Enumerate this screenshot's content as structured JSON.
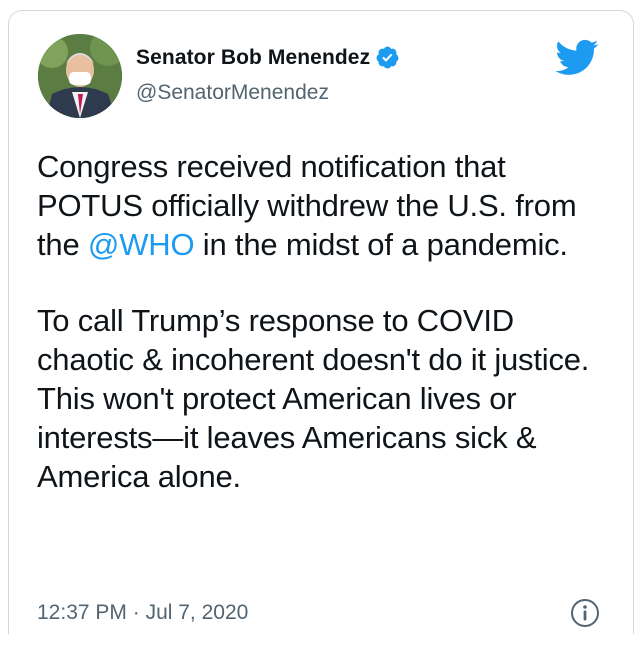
{
  "tweet": {
    "author_name": "Senator Bob Menendez",
    "handle": "@SenatorMenendez",
    "paragraph1": {
      "before_mention": "Congress received notification that POTUS officially withdrew the U.S. from the ",
      "mention": "@WHO",
      "after_mention": " in the midst of a pandemic."
    },
    "paragraph2": "To call Trump’s response to COVID chaotic & incoherent doesn't do it justice. This won't protect American lives or interests—it leaves Americans sick & America alone.",
    "time": "12:37 PM",
    "separator": " · ",
    "date": "Jul 7, 2020"
  },
  "icons": {
    "avatar": "profile-photo",
    "verified": "verified-badge-icon",
    "brand": "twitter-bird-icon",
    "info": "info-icon"
  },
  "colors": {
    "accent": "#1d9bf0",
    "text": "#0f1419",
    "secondary": "#536471"
  }
}
